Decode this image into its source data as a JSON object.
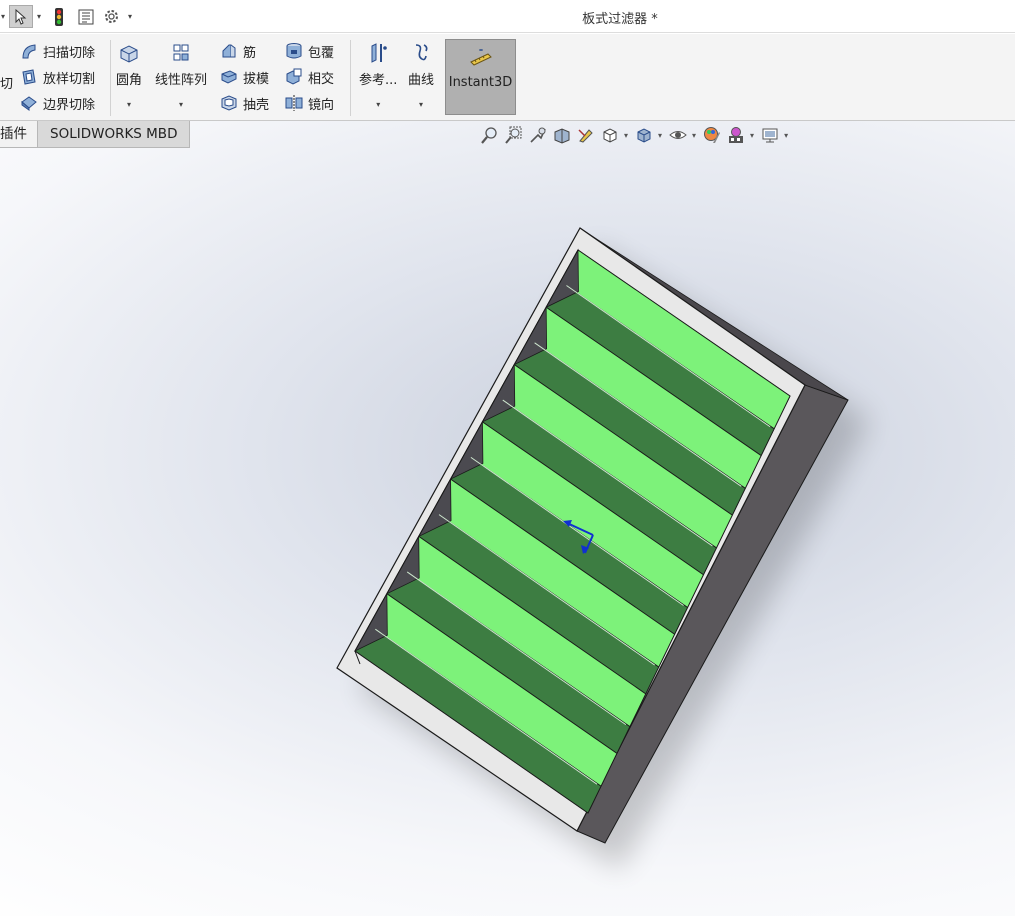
{
  "window": {
    "title": "板式过滤器 *"
  },
  "quickaccess": {
    "icons": [
      "select-pointer-icon",
      "traffic-light-icon",
      "file-properties-icon",
      "options-gear-icon"
    ]
  },
  "ribbon": {
    "cut_partial": "切",
    "sweep_cut": "扫描切除",
    "loft_cut": "放样切割",
    "boundary_cut": "边界切除",
    "fillet": "圆角",
    "linear_pattern": "线性阵列",
    "rib": "筋",
    "draft": "拔模",
    "shell": "抽壳",
    "wrap": "包覆",
    "intersect": "相交",
    "mirror": "镜向",
    "reference": "参考...",
    "curves": "曲线",
    "instant3d": "Instant3D"
  },
  "tabs": [
    {
      "label": "插件",
      "active": false
    },
    {
      "label": "SOLIDWORKS MBD",
      "active": true
    }
  ],
  "heads_up": {
    "icons": [
      "zoom-to-fit-icon",
      "zoom-to-area-icon",
      "previous-view-icon",
      "section-view-icon",
      "dynamic-annotation-icon",
      "view-orientation-icon",
      "display-style-icon",
      "hide-show-icon",
      "edit-appearance-icon",
      "apply-scene-icon",
      "view-settings-icon"
    ]
  },
  "model": {
    "name": "板式过滤器",
    "colors": {
      "frame": "#e8e8e8",
      "side": "#5a575b",
      "slat_light": "#7df27a",
      "slat_dark": "#3d7d42",
      "edge": "#1a1a1a",
      "triad": "#1030d0"
    }
  }
}
